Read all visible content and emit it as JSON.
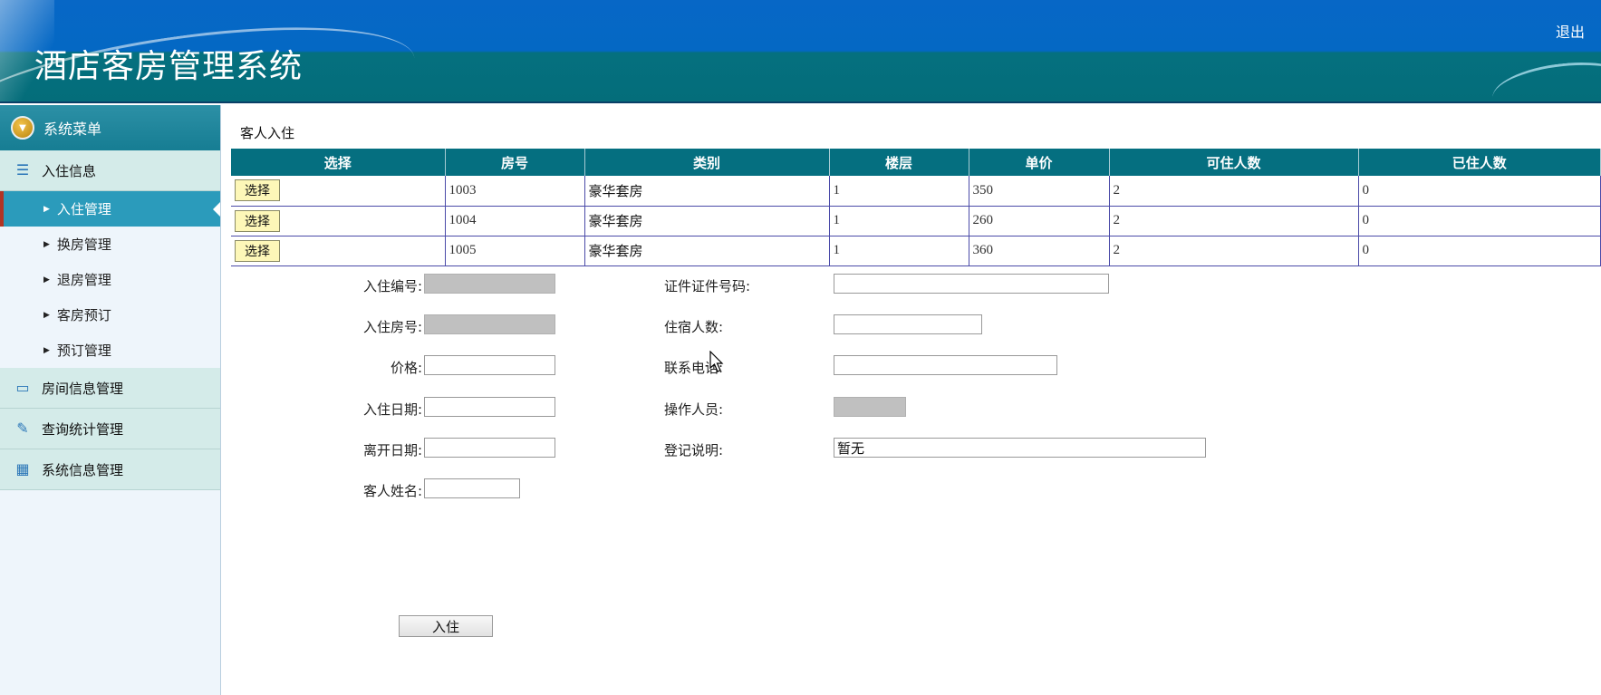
{
  "app": {
    "title": "酒店客房管理系统",
    "logout_label": "退出"
  },
  "sidebar": {
    "menu_title": "系统菜单",
    "sections": [
      {
        "label": "入住信息",
        "icon": "list-icon"
      },
      {
        "label": "房间信息管理",
        "icon": "chat-icon"
      },
      {
        "label": "查询统计管理",
        "icon": "edit-icon"
      },
      {
        "label": "系统信息管理",
        "icon": "calendar-icon"
      }
    ],
    "items": [
      {
        "label": "入住管理",
        "active": true
      },
      {
        "label": "换房管理"
      },
      {
        "label": "退房管理"
      },
      {
        "label": "客房预订"
      },
      {
        "label": "预订管理"
      }
    ]
  },
  "main": {
    "breadcrumb": "客人入住",
    "table": {
      "columns": [
        "选择",
        "房号",
        "类别",
        "楼层",
        "单价",
        "可住人数",
        "已住人数"
      ],
      "select_label": "选择",
      "rows": [
        [
          "1003",
          "豪华套房",
          "1",
          "350",
          "2",
          "0"
        ],
        [
          "1004",
          "豪华套房",
          "1",
          "260",
          "2",
          "0"
        ],
        [
          "1005",
          "豪华套房",
          "1",
          "360",
          "2",
          "0"
        ]
      ]
    },
    "form": {
      "checkin_no_label": "入住编号:",
      "checkin_no_value": "",
      "room_no_label": "入住房号:",
      "room_no_value": "",
      "price_label": "价格:",
      "price_value": "",
      "checkin_date_label": "入住日期:",
      "checkin_date_value": "",
      "leave_date_label": "离开日期:",
      "leave_date_value": "",
      "guest_name_label": "客人姓名:",
      "guest_name_value": "",
      "id_no_label": "证件证件号码:",
      "id_no_value": "",
      "guests_label": "住宿人数:",
      "guests_value": "",
      "phone_label": "联系电话:",
      "phone_value": "",
      "operator_label": "操作人员:",
      "operator_value": "",
      "note_label": "登记说明:",
      "note_value": "暂无",
      "submit_label": "入住"
    }
  },
  "colors": {
    "header_top": "#0767c6",
    "header_bottom": "#046d7a",
    "table_header": "#056f80",
    "active_item": "#2b9bbb",
    "select_button": "#fdf7b8"
  }
}
